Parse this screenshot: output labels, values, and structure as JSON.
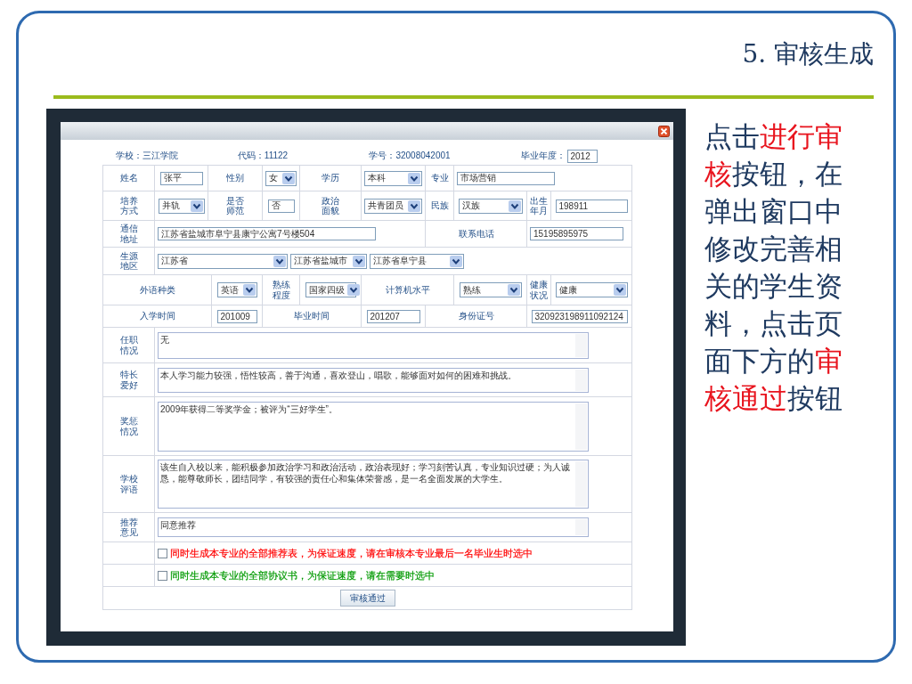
{
  "slide_title": "5. 审核生成",
  "dialog": {
    "info": [
      {
        "kind": "text",
        "text": "学校：三江学院"
      },
      {
        "kind": "text",
        "text": "代码：11122"
      },
      {
        "kind": "text",
        "text": "学号：32008042001"
      },
      {
        "kind": "input",
        "label": "毕业年度：",
        "value": "2012"
      }
    ],
    "rows": [
      {
        "fields": [
          {
            "label": "姓名",
            "controls": [
              {
                "kind": "input",
                "value": "张平"
              }
            ]
          },
          {
            "label": "性别",
            "controls": [
              {
                "kind": "select",
                "value": "女"
              }
            ]
          },
          {
            "label": "学历",
            "controls": [
              {
                "kind": "select",
                "value": "本科"
              }
            ]
          },
          {
            "label": "专业",
            "controls": [
              {
                "kind": "input",
                "value": "市场营销"
              }
            ]
          }
        ]
      },
      {
        "fields": [
          {
            "label": "培养方式",
            "controls": [
              {
                "kind": "select",
                "value": "并轨"
              }
            ]
          },
          {
            "label": "是否师范",
            "controls": [
              {
                "kind": "input",
                "value": "否"
              }
            ]
          },
          {
            "label": "政治面貌",
            "controls": [
              {
                "kind": "select",
                "value": "共青团员"
              }
            ]
          },
          {
            "label": "民族",
            "controls": [
              {
                "kind": "select",
                "value": "汉族"
              }
            ]
          },
          {
            "label": "出生年月",
            "controls": [
              {
                "kind": "input",
                "value": "198911"
              }
            ]
          }
        ]
      },
      {
        "fields": [
          {
            "label": "通信地址",
            "controls": [
              {
                "kind": "input",
                "value": "江苏省盐城市阜宁县康宁公寓7号楼504"
              }
            ]
          },
          {
            "label": "联系电话",
            "controls": [
              {
                "kind": "input",
                "value": "15195895975"
              }
            ]
          }
        ]
      },
      {
        "fields": [
          {
            "label": "生源地区",
            "controls": [
              {
                "kind": "select",
                "value": "江苏省"
              },
              {
                "kind": "select",
                "value": "江苏省盐城市"
              },
              {
                "kind": "select",
                "value": "江苏省阜宁县"
              }
            ]
          }
        ]
      },
      {
        "fields": [
          {
            "label": "外语种类",
            "controls": [
              {
                "kind": "select",
                "value": "英语"
              }
            ]
          },
          {
            "label": "熟练程度",
            "controls": [
              {
                "kind": "select",
                "value": "国家四级"
              }
            ]
          },
          {
            "label": "计算机水平",
            "controls": [
              {
                "kind": "select",
                "value": "熟练"
              }
            ]
          },
          {
            "label": "健康状况",
            "controls": [
              {
                "kind": "select",
                "value": "健康"
              }
            ]
          }
        ]
      },
      {
        "fields": [
          {
            "label": "入学时间",
            "controls": [
              {
                "kind": "input",
                "value": "201009"
              }
            ]
          },
          {
            "label": "毕业时间",
            "controls": [
              {
                "kind": "input",
                "value": "201207"
              }
            ]
          },
          {
            "label": "身份证号",
            "controls": [
              {
                "kind": "input",
                "value": "320923198911092124"
              }
            ]
          }
        ]
      }
    ],
    "text_areas": [
      {
        "label": "任职情况",
        "value": "无"
      },
      {
        "label": "特长爱好",
        "value": "本人学习能力较强，悟性较高，善于沟通，喜欢登山，唱歌，能够面对如何的困难和挑战。"
      },
      {
        "label": "奖惩情况",
        "value": "2009年获得二等奖学金；被评为“三好学生”。"
      },
      {
        "label": "学校评语",
        "value": "该生自入校以来，能积极参加政治学习和政治活动，政治表现好；学习刻苦认真，专业知识过硬；为人诚恳，能尊敬师长，团结同学，有较强的责任心和集体荣誉感，是一名全面发展的大学生。"
      },
      {
        "label": "推荐意见",
        "value": "同意推荐"
      }
    ],
    "checks": [
      {
        "text": "同时生成本专业的全部推荐表，为保证速度，请在审核本专业最后一名毕业生时选中",
        "checked": false,
        "color": "#ff0000"
      },
      {
        "text": "同时生成本专业的全部协议书，为保证速度，请在需要时选中",
        "checked": false,
        "color": "#009900"
      }
    ],
    "submit_button": "审核通过"
  },
  "instructions": [
    {
      "text": "点击",
      "highlight": false
    },
    {
      "text": "进行审核",
      "highlight": true
    },
    {
      "text": "按钮，在弹出窗口中修改完善相关的学生资料，点击页面下方的",
      "highlight": false
    },
    {
      "text": "审核通过",
      "highlight": true
    },
    {
      "text": "按钮",
      "highlight": false
    }
  ]
}
